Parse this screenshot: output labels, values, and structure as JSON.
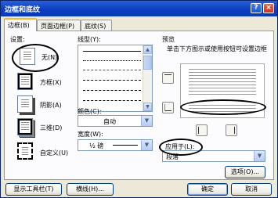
{
  "window": {
    "title": "边框和底纹",
    "help_glyph": "?",
    "close_glyph": "×"
  },
  "tabs": [
    {
      "label": "边框(B)",
      "active": true
    },
    {
      "label": "页面边框(P)",
      "active": false
    },
    {
      "label": "底纹(S)",
      "active": false
    }
  ],
  "settings": {
    "group_label": "设置:",
    "items": [
      {
        "label": "无(N)",
        "icon": "no-border-icon"
      },
      {
        "label": "方框(X)",
        "icon": "box-border-icon"
      },
      {
        "label": "阴影(A)",
        "icon": "shadow-border-icon"
      },
      {
        "label": "三维(D)",
        "icon": "3d-border-icon"
      },
      {
        "label": "自定义(U)",
        "icon": "custom-border-icon"
      }
    ]
  },
  "line_style": {
    "label": "线型(Y):",
    "styles": [
      "solid",
      "dotted",
      "dashed-short",
      "dashed",
      "dash-dot",
      "dash-dot-dot"
    ]
  },
  "color": {
    "label": "颜色(C):",
    "value": "自动"
  },
  "width": {
    "label": "宽度(W):",
    "value": "½ 磅"
  },
  "preview": {
    "label": "预览",
    "hint": "单击下方图示或使用按钮可设置边框"
  },
  "apply_to": {
    "label": "应用于(L):",
    "value": "段落"
  },
  "buttons": {
    "options": "选项(O)...",
    "show_toolbar": "显示工具栏(T)",
    "horizontal_line": "横线(H)...",
    "ok": "确定",
    "cancel": "取消"
  },
  "glyphs": {
    "down_arrow": "▼",
    "up_arrow": "▲"
  }
}
